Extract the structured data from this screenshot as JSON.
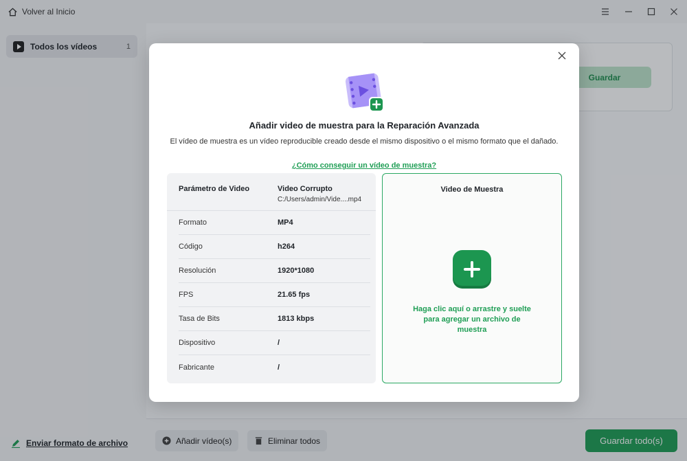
{
  "titlebar": {
    "home_label": "Volver al Inicio"
  },
  "sidebar": {
    "item": {
      "label": "Todos los vídeos",
      "count": "1"
    },
    "footer_link": "Enviar formato de archivo"
  },
  "background": {
    "save_label": "Guardar"
  },
  "bottombar": {
    "add_label": "Añadir vídeo(s)",
    "delete_label": "Eliminar todos",
    "save_all_label": "Guardar todo(s)"
  },
  "modal": {
    "title": "Añadir video de muestra para la Reparación Avanzada",
    "description": "El vídeo de muestra es un vídeo reproducible creado desde el mismo dispositivo o el mismo formato que el dañado.",
    "help_link": "¿Cómo conseguir un vídeo de muestra?",
    "params": {
      "header_param": "Parámetro de Video",
      "header_corrupt": "Video Corrupto",
      "corrupt_path": "C:/Users/admin/Vide....mp4",
      "rows": [
        {
          "key": "Formato",
          "value": "MP4"
        },
        {
          "key": "Código",
          "value": "h264"
        },
        {
          "key": "Resolución",
          "value": "1920*1080"
        },
        {
          "key": "FPS",
          "value": "21.65 fps"
        },
        {
          "key": "Tasa de Bits",
          "value": "1813 kbps"
        },
        {
          "key": "Dispositivo",
          "value": "/"
        },
        {
          "key": "Fabricante",
          "value": "/"
        }
      ]
    },
    "sample": {
      "title": "Video de Muestra",
      "hint": "Haga clic aquí o arrastre y suelte para agregar un archivo de muestra"
    }
  },
  "colors": {
    "accent": "#1f9e55",
    "accent_light": "#bfe5cc",
    "hero_purple": "#8b6cf0"
  }
}
